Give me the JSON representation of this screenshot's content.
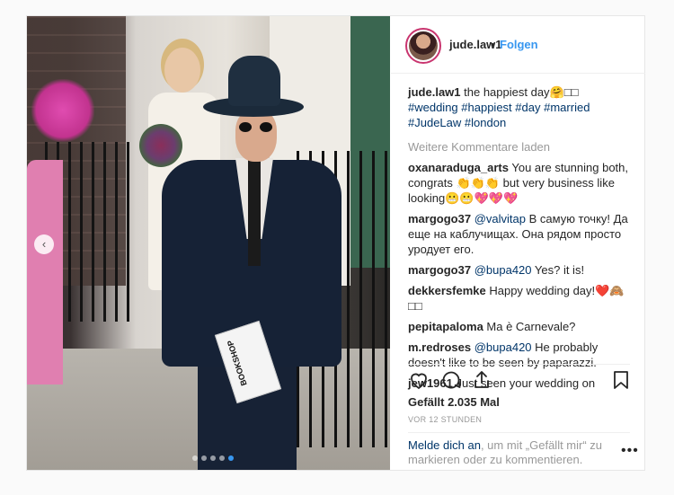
{
  "post": {
    "username": "jude.law1",
    "follow_label": "Folgen",
    "follow_separator": "•",
    "caption": {
      "username": "jude.law1",
      "text": " the happiest day",
      "emoji": "🤗",
      "boxes": "□□",
      "hashtags": [
        "#wedding",
        "#happiest",
        "#day",
        "#married",
        "#JudeLaw",
        "#london"
      ]
    },
    "load_more_label": "Weitere Kommentare laden",
    "comments": [
      {
        "user": "oxanaraduga_arts",
        "text": " You are stunning both, congrats 👏👏👏 but very business like looking😬😬💖💖💖"
      },
      {
        "user": "margogo37",
        "mention": "@valvitap",
        "text": " В самую точку! Да еще на каблучищах. Она рядом просто уродует его."
      },
      {
        "user": "margogo37",
        "mention": "@bupa420",
        "text": " Yes? it is!"
      },
      {
        "user": "dekkersfemke",
        "text": " Happy wedding day!❤️🙈 □□"
      },
      {
        "user": "pepitapaloma",
        "text": " Ma è Carnevale?"
      },
      {
        "user": "m.redroses",
        "mention": "@bupa420",
        "text": " He probably doesn't like to be seen by paparazzi."
      },
      {
        "user": "jew1961",
        "text": " Just seen your wedding on"
      }
    ],
    "likes_text": "Gefällt 2.035 Mal",
    "timestamp": "VOR 12 STUNDEN",
    "login_link": "Melde dich an",
    "login_text": ", um mit „Gefällt mir“ zu markieren oder zu kommentieren.",
    "options_label": "•••",
    "photo_bag_text": "BOOKSHOP",
    "carousel": {
      "count": 5,
      "active_index": 4
    }
  },
  "colors": {
    "accent": "#3897f0",
    "mention": "#003569",
    "muted": "#999999"
  },
  "icons": [
    "chevron-left-icon",
    "heart-icon",
    "comment-icon",
    "share-icon",
    "bookmark-icon",
    "more-options-icon"
  ]
}
